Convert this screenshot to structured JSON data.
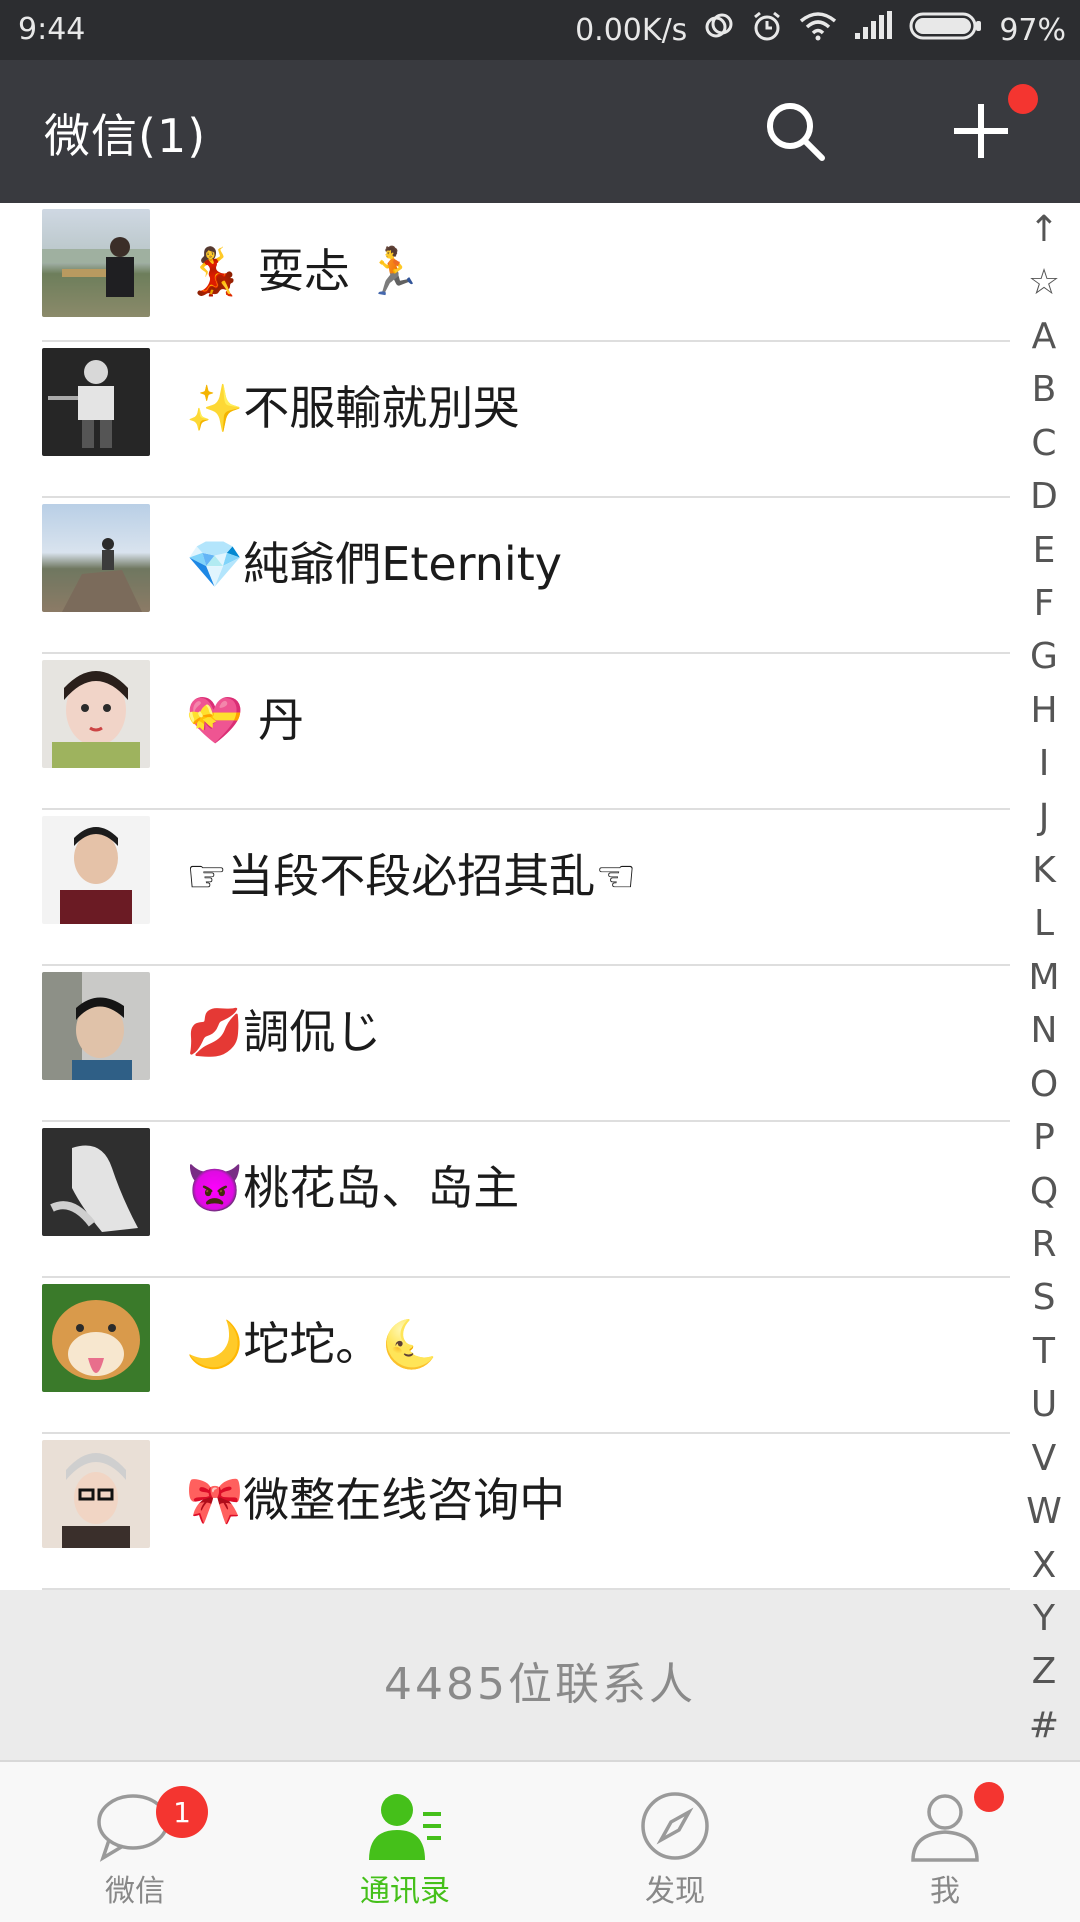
{
  "status_bar": {
    "time": "9:44",
    "speed": "0.00K/s",
    "battery": "97%"
  },
  "header": {
    "title": "微信(1)",
    "search_icon": "search-icon",
    "add_icon": "plus-icon",
    "add_has_dot": true
  },
  "contacts": [
    {
      "name": "💃 耍忐 🏃"
    },
    {
      "name": "✨不服輸就別哭"
    },
    {
      "name": "💎純爺們Eternity"
    },
    {
      "name": "💝 丹"
    },
    {
      "name": "☞当段不段必招其乱☜"
    },
    {
      "name": "💋調侃じ"
    },
    {
      "name": "👿桃花岛、岛主"
    },
    {
      "name": "🌙坨坨。🌜"
    },
    {
      "name": "🎀微整在线咨询中"
    }
  ],
  "footer": {
    "count_text": "4485位联系人"
  },
  "index_bar": [
    "↑",
    "☆",
    "A",
    "B",
    "C",
    "D",
    "E",
    "F",
    "G",
    "H",
    "I",
    "J",
    "K",
    "L",
    "M",
    "N",
    "O",
    "P",
    "Q",
    "R",
    "S",
    "T",
    "U",
    "V",
    "W",
    "X",
    "Y",
    "Z",
    "#"
  ],
  "tabs": [
    {
      "label": "微信",
      "icon": "chat-bubble-icon",
      "badge": "1"
    },
    {
      "label": "通讯录",
      "icon": "contacts-icon",
      "active": true
    },
    {
      "label": "发现",
      "icon": "compass-icon"
    },
    {
      "label": "我",
      "icon": "person-icon",
      "has_dot": true
    }
  ],
  "colors": {
    "header_bg": "#393a3f",
    "status_bg": "#2c2d30",
    "accent_green": "#45c01a",
    "badge_red": "#f43530"
  }
}
